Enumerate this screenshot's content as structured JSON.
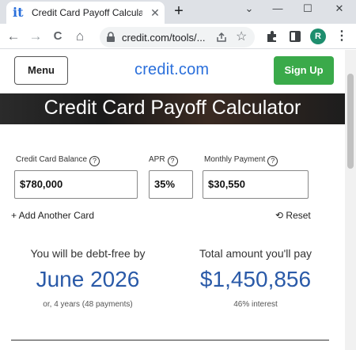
{
  "browser": {
    "tab_title": "Credit Card Payoff Calculator",
    "tab_close": "✕",
    "new_tab": "+",
    "window_controls": {
      "dropdown": "⌄",
      "minimize": "—",
      "maximize": "☐",
      "close": "✕"
    },
    "url": "credit.com/tools/...",
    "profile_initial": "R",
    "nav": {
      "back": "←",
      "forward": "→",
      "reload": "C",
      "home": "⌂"
    }
  },
  "header": {
    "menu_label": "Menu",
    "logo_text": "credit.com",
    "signup_label": "Sign Up",
    "accent_color": "#2a6fdb",
    "signup_color": "#3aaa4a"
  },
  "hero": {
    "title": "Credit Card Payoff Calculator"
  },
  "form": {
    "balance_label": "Credit Card Balance",
    "balance_value": "$780,000",
    "apr_label": "APR",
    "apr_value": "35%",
    "payment_label": "Monthly Payment",
    "payment_value": "$30,550",
    "help_glyph": "?",
    "add_card_label": "+ Add Another Card",
    "reset_label": "Reset"
  },
  "results": {
    "debt_free_label": "You will be debt-free by",
    "debt_free_date": "June 2026",
    "debt_free_sub": "or, 4 years (48 payments)",
    "total_label": "Total amount you'll pay",
    "total_value": "$1,450,856",
    "total_sub": "46% interest"
  }
}
